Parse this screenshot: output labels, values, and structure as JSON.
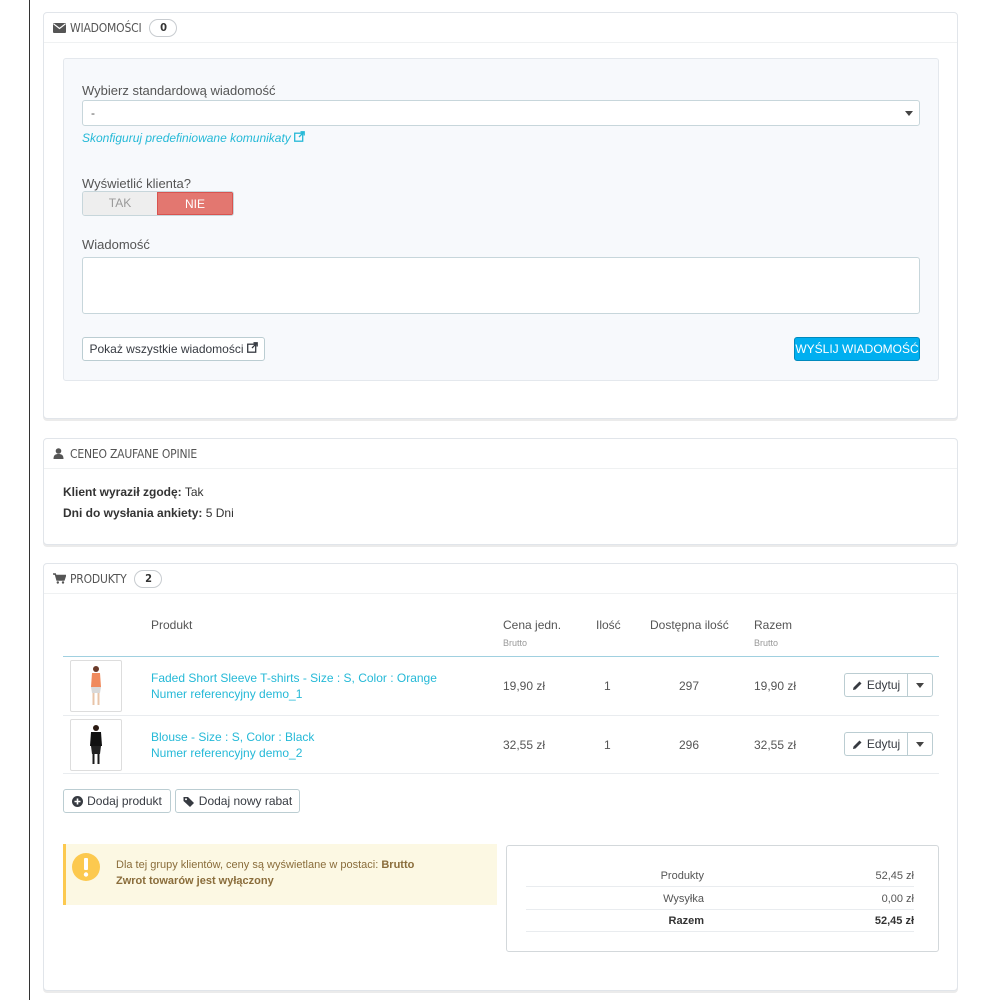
{
  "messages": {
    "title": "Wiadomości",
    "count": "0",
    "select_label": "Wybierz standardową wiadomość",
    "select_value": "-",
    "configure_link": "Skonfiguruj predefiniowane komunikaty",
    "show_customer_label": "Wyświetlić klienta?",
    "toggle_yes": "TAK",
    "toggle_no": "NIE",
    "message_label": "Wiadomość",
    "show_all_button": "Pokaż wszystkie wiadomości",
    "send_button": "WYŚLIJ WIADOMOŚĆ"
  },
  "ceneo": {
    "title": "Ceneo Zaufane Opinie",
    "consent_label": "Klient wyraził zgodę:",
    "consent_value": "Tak",
    "days_label": "Dni do wysłania ankiety:",
    "days_value": "5 Dni"
  },
  "products": {
    "title": "Produkty",
    "count": "2",
    "columns": {
      "product": "Produkt",
      "unit_price": "Cena jedn.",
      "unit_price_sub": "Brutto",
      "quantity": "Ilość",
      "available": "Dostępna ilość",
      "total": "Razem",
      "total_sub": "Brutto"
    },
    "rows": [
      {
        "name": "Faded Short Sleeve T-shirts - Size : S, Color : Orange",
        "reference": "Numer referencyjny demo_1",
        "price": "19,90 zł",
        "qty": "1",
        "available": "297",
        "total": "19,90 zł",
        "edit": "Edytuj"
      },
      {
        "name": "Blouse - Size : S, Color : Black",
        "reference": "Numer referencyjny demo_2",
        "price": "32,55 zł",
        "qty": "1",
        "available": "296",
        "total": "32,55 zł",
        "edit": "Edytuj"
      }
    ],
    "add_product_button": "Dodaj produkt",
    "add_discount_button": "Dodaj nowy rabat",
    "alert_text": "Dla tej grupy klientów, ceny są wyświetlane w postaci:",
    "alert_bold": "Brutto",
    "alert_line2": "Zwrot towarów jest wyłączony",
    "totals": [
      {
        "label": "Produkty",
        "value": "52,45 zł"
      },
      {
        "label": "Wysyłka",
        "value": "0,00 zł"
      },
      {
        "label": "Razem",
        "value": "52,45 zł"
      }
    ]
  },
  "colors": {
    "accent": "#25b9d7",
    "primary_button": "#00aff0",
    "toggle_no": "#e37770",
    "alert_bg": "#fcf8e3"
  }
}
